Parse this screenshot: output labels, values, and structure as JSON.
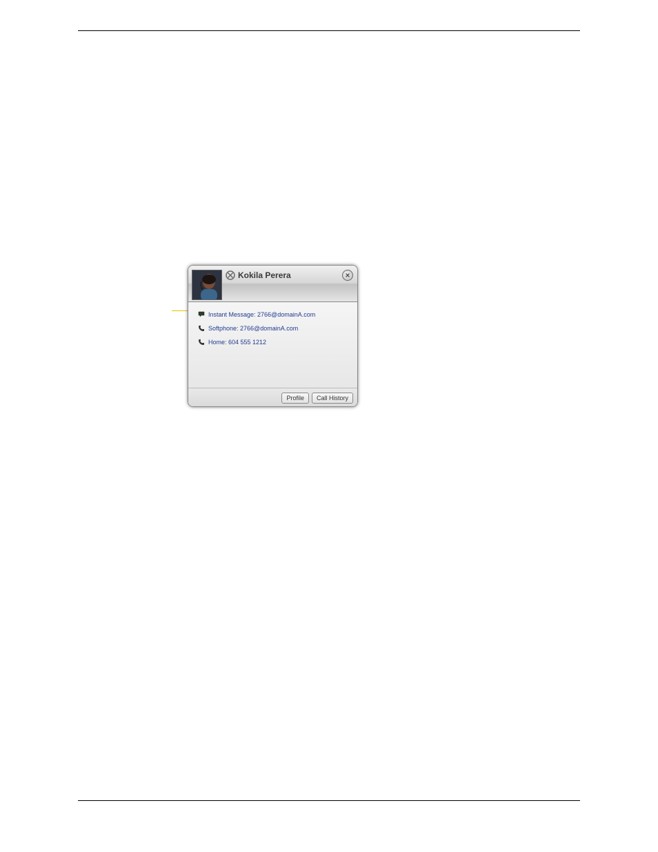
{
  "contact": {
    "name": "Kokila Perera",
    "status": "offline"
  },
  "methods": {
    "im": "Instant Message:  2766@domainA.com",
    "softphone": "Softphone:  2766@domainA.com",
    "home": "Home:  604 555 1212"
  },
  "buttons": {
    "profile": "Profile",
    "call_history": "Call History"
  }
}
